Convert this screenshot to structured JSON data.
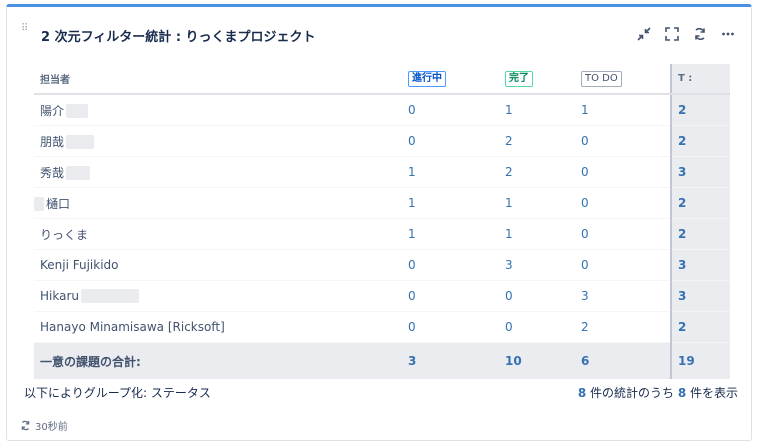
{
  "gadget": {
    "title": "2 次元フィルター統計 : りっくまプロジェクト",
    "icons": [
      "minimize-icon",
      "fullscreen-icon",
      "refresh-icon",
      "more-icon"
    ]
  },
  "table": {
    "header": {
      "assignee": "担当者",
      "col1": "進行中",
      "col2": "完了",
      "col3": "TO DO",
      "total": "T :"
    },
    "rows": [
      {
        "name": "陽介",
        "redacted": true,
        "c1": "0",
        "c2": "1",
        "c3": "1",
        "total": "2"
      },
      {
        "name": "朋哉",
        "redacted": true,
        "c1": "0",
        "c2": "2",
        "c3": "0",
        "total": "2"
      },
      {
        "name": "秀哉",
        "redacted": true,
        "c1": "1",
        "c2": "2",
        "c3": "0",
        "total": "3"
      },
      {
        "name": "樋口",
        "redacted": true,
        "c1": "1",
        "c2": "1",
        "c3": "0",
        "total": "2"
      },
      {
        "name": "りっくま",
        "redacted": false,
        "c1": "1",
        "c2": "1",
        "c3": "0",
        "total": "2"
      },
      {
        "name": "Kenji Fujikido",
        "redacted": false,
        "c1": "0",
        "c2": "3",
        "c3": "0",
        "total": "3"
      },
      {
        "name": "Hikaru",
        "redacted": true,
        "c1": "0",
        "c2": "0",
        "c3": "3",
        "total": "3"
      },
      {
        "name": "Hanayo Minamisawa [Ricksoft]",
        "redacted": false,
        "c1": "0",
        "c2": "0",
        "c3": "2",
        "total": "2"
      }
    ],
    "footer": {
      "label": "一意の課題の合計:",
      "c1": "3",
      "c2": "10",
      "c3": "6",
      "total": "19"
    }
  },
  "group_by": "以下によりグループ化: ステータス",
  "showing": {
    "count": "8",
    "total": "8",
    "text_mid": " 件の統計のうち ",
    "text_end": " 件を表示"
  },
  "updated": "30秒前",
  "colors": {
    "accent_top": "#4a90e2",
    "link": "#3572b0",
    "total_bg": "#ebecf0"
  }
}
